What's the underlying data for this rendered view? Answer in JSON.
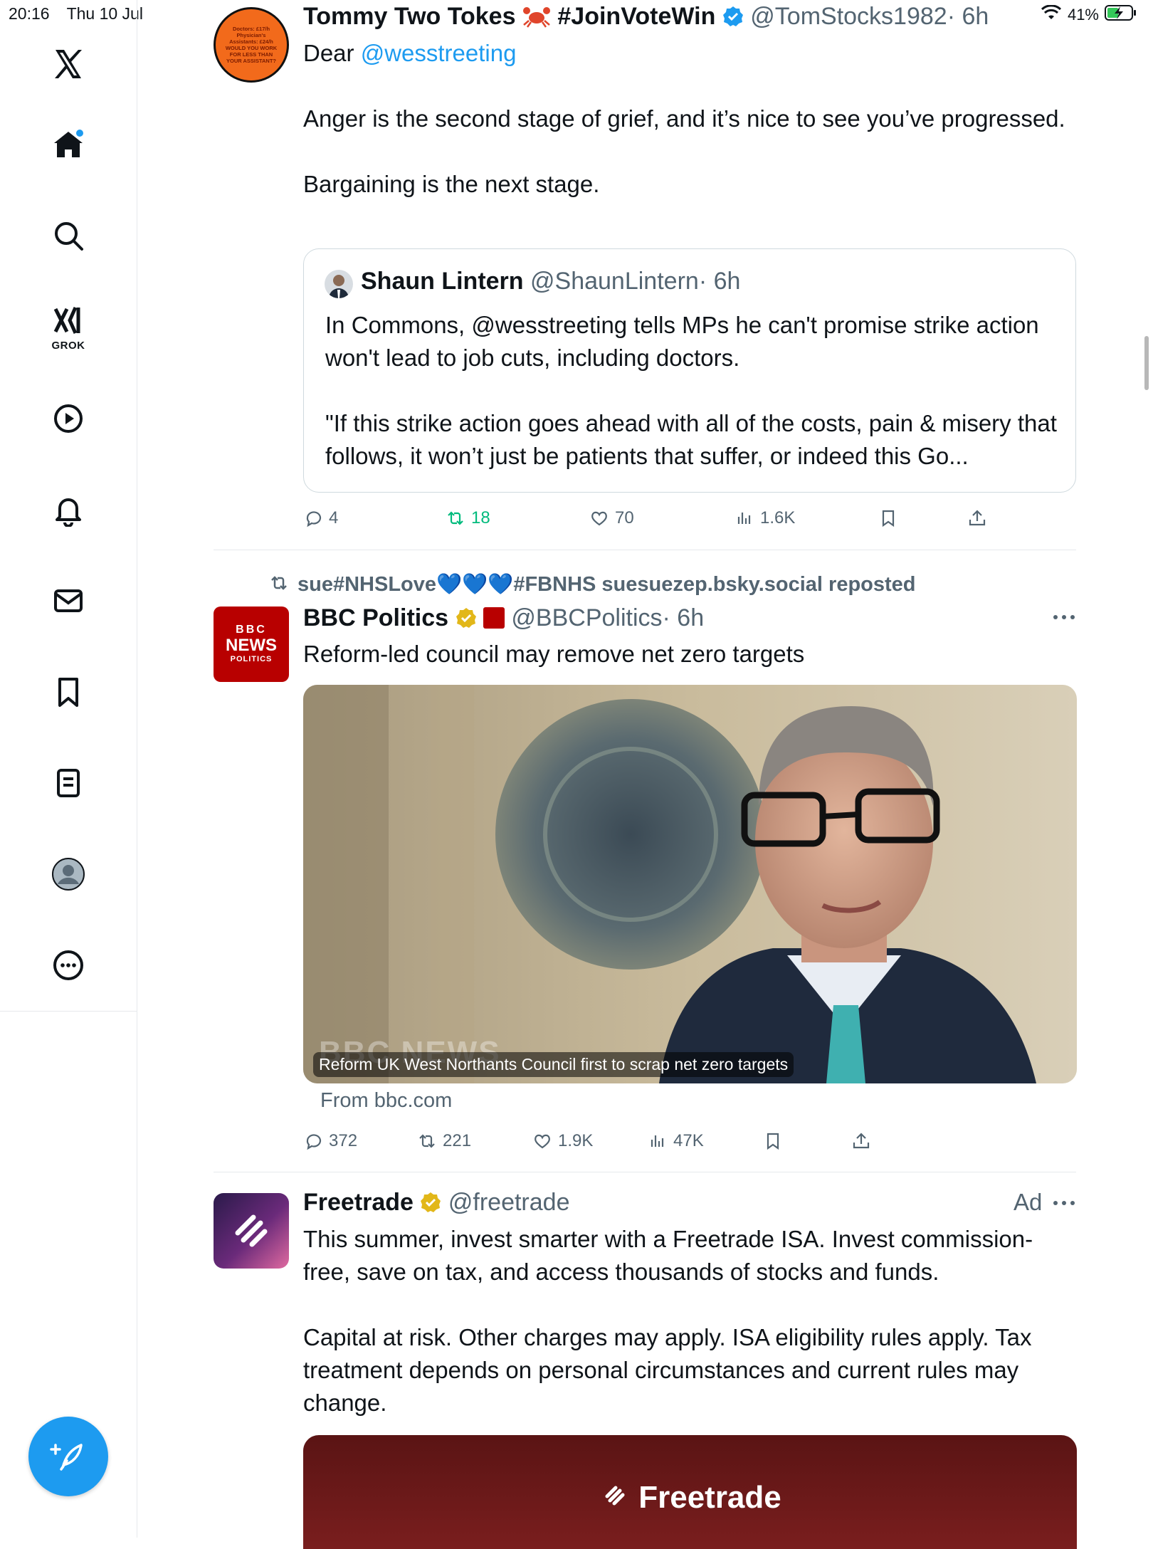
{
  "status": {
    "time": "20:16",
    "date": "Thu 10 Jul",
    "battery": "41%"
  },
  "sidebar": {
    "items": [
      "x-logo",
      "home",
      "search",
      "grok",
      "videos",
      "notifications",
      "messages",
      "bookmarks",
      "lists",
      "profile",
      "more"
    ],
    "grok_label": "GROK"
  },
  "tweet1": {
    "name": "Tommy Two Tokes",
    "hashtag": "#JoinVoteWin",
    "handle": "@TomStocks1982",
    "time": "· 6h",
    "dear": "Dear",
    "mention": "@wesstreeting",
    "para1": "Anger is the second stage of grief, and it’s nice to see you’ve progressed.",
    "para2": "Bargaining is the next stage.",
    "avatar_text": "Doctors: £17/h Physician's Assistants: £24/h WOULD YOU WORK FOR LESS THAN YOUR ASSISTANT?",
    "quote": {
      "name": "Shaun Lintern",
      "handle": "@ShaunLintern",
      "time": "· 6h",
      "para1": "In Commons, @wesstreeting tells MPs he can't promise strike action won't lead to job cuts, including doctors.",
      "para2": "\"If this strike action goes ahead with all of the costs, pain & misery that follows, it won’t just be patients that suffer, or indeed this Go..."
    },
    "replies": "4",
    "reposts": "18",
    "likes": "70",
    "views": "1.6K"
  },
  "tweet2": {
    "repost_label": "sue#NHSLove💙💙💙#FBNHS suesuezep.bsky.social reposted",
    "name": "BBC Politics",
    "handle": "@BBCPolitics",
    "time": "· 6h",
    "text": "Reform-led council may remove net zero targets",
    "avatar_lines": [
      "BBC",
      "NEWS",
      "POLITICS"
    ],
    "image_caption": "Reform UK West Northants Council first to scrap net zero targets",
    "image_watermark": "BBC NEWS",
    "from": "From bbc.com",
    "replies": "372",
    "reposts": "221",
    "likes": "1.9K",
    "views": "47K"
  },
  "tweet3": {
    "name": "Freetrade",
    "handle": "@freetrade",
    "ad": "Ad",
    "para1": "This summer, invest smarter with a Freetrade ISA. Invest commission-free, save on tax, and access thousands of stocks and funds.",
    "para2": "Capital at risk. Other charges may apply. ISA eligibility rules apply. Tax treatment depends on personal circumstances and current rules may change.",
    "banner_text": "Freetrade"
  },
  "colors": {
    "accent": "#1d9bf0",
    "repost_green": "#00ba7c",
    "muted": "#536471",
    "bbc_red": "#b80000"
  }
}
